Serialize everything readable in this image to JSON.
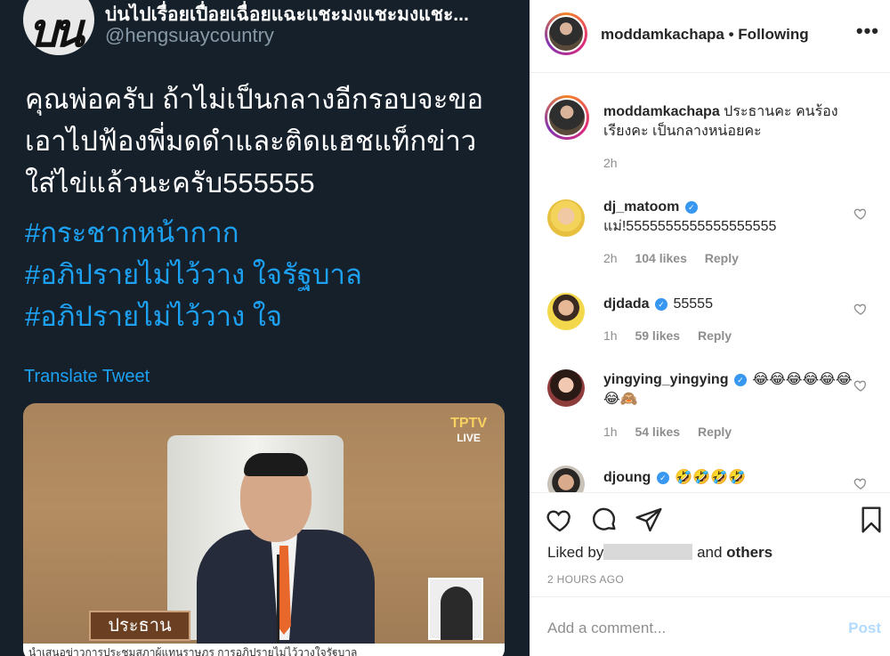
{
  "tweet": {
    "avatar_text": "บน",
    "display_name": "บ่นไปเรื่อยเปื่อยเฉื่อยแฉะแชะมงแชะมงแชะ...",
    "handle": "@hengsuaycountry",
    "body_lines": [
      "คุณพ่อครับ ถ้าไม่เป็นกลางอีกรอบจะขอ",
      "เอาไปฟ้องพี่มดดำและติดแฮชแท็กข่าว",
      "ใส่ไข่แล้วนะครับ555555"
    ],
    "hashtags": [
      "#กระชากหน้ากาก",
      "#อภิปรายไม่ไว้วาง ใจรัฐบาล",
      "#อภิปรายไม่ไว้วาง ใจ"
    ],
    "translate_label": "Translate Tweet",
    "media": {
      "channel_logo": "TPTV",
      "channel_sub": "LIVE",
      "nameplate": "ประธาน",
      "ticker": "นำเสนอข่าวการประชุมสภาผู้แทนราษฎร การอภิปรายไม่ไว้วางใจรัฐบาล"
    }
  },
  "instagram": {
    "header": {
      "username": "moddamkachapa",
      "follow_status": "• Following",
      "more_icon": "more-horizontal-icon"
    },
    "caption": {
      "username": "moddamkachapa",
      "text": "ประธานคะ คนร้องเรียงคะ เป็นกลางหน่อยคะ",
      "time": "2h"
    },
    "comments": [
      {
        "username": "dj_matoom",
        "verified": true,
        "text": "แม่!5555555555555555555",
        "time": "2h",
        "likes": "104 likes",
        "reply": "Reply"
      },
      {
        "username": "djdada",
        "verified": true,
        "text": "55555",
        "time": "1h",
        "likes": "59 likes",
        "reply": "Reply"
      },
      {
        "username": "yingying_yingying",
        "verified": true,
        "text": "😂😂😂😂😂😂😂🙈",
        "time": "1h",
        "likes": "54 likes",
        "reply": "Reply"
      },
      {
        "username": "djoung",
        "verified": true,
        "text": "🤣🤣🤣🤣",
        "time": "",
        "likes": "",
        "reply": ""
      }
    ],
    "liked_by_prefix": "Liked by",
    "liked_by_suffix": "and",
    "liked_by_others": "others",
    "post_time": "2 HOURS AGO",
    "comment_placeholder": "Add a comment...",
    "post_label": "Post",
    "colors": {
      "link_blue": "#1da1f2",
      "verified_blue": "#3897f0",
      "post_disabled": "#b3dbff"
    }
  }
}
